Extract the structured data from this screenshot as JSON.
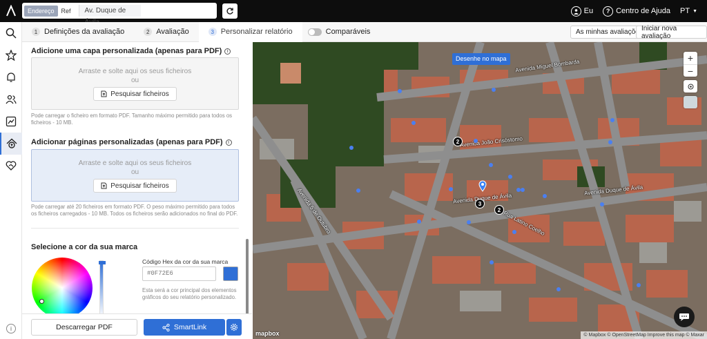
{
  "topbar": {
    "search_modes": [
      "Endereço",
      "Ref"
    ],
    "address_value": "Av. Duque de Ávila ...",
    "user_label": "Eu",
    "help_label": "Centro de Ajuda",
    "language": "PT"
  },
  "tabs": [
    {
      "num": "1",
      "label": "Definições da avaliação"
    },
    {
      "num": "2",
      "label": "Avaliação"
    },
    {
      "num": "3",
      "label": "Personalizar relatório"
    }
  ],
  "toggle_label": "Comparáveis",
  "buttons": {
    "my_evaluations": "As minhas avaliações",
    "new_evaluation": "Iniciar nova avaliação",
    "download_pdf": "Descarregar PDF",
    "smartlink": "SmartLink"
  },
  "cover": {
    "title": "Adicione uma capa personalizada (apenas para PDF)",
    "drop_line1": "Arraste e solte aqui os seus ficheiros",
    "drop_or": "ou",
    "button": "Pesquisar ficheiros",
    "note": "Pode carregar o ficheiro em formato PDF. Tamanho máximo permitido para todos os ficheiros - 10 MB."
  },
  "pages": {
    "title": "Adicionar páginas personalizadas (apenas para PDF)",
    "drop_line1": "Arraste e solte aqui os seus ficheiros",
    "drop_or": "ou",
    "button": "Pesquisar ficheiros",
    "note": "Pode carregar até 20 ficheiros em formato PDF. O peso máximo permitido para todos os ficheiros carregados - 10 MB. Todos os ficheiros serão adicionados no final do PDF."
  },
  "brand": {
    "title": "Selecione a cor da sua marca",
    "hex_label": "Código Hex da cor da sua marca",
    "hex_value": "#0F72E6",
    "swatch_color": "#2f6fd6",
    "note": "Esta será a cor principal dos elementos gráficos do seu relatório personalizado."
  },
  "map": {
    "draw_button": "Desenhe no mapa",
    "streets": [
      "Avenida Miguel Bombarda",
      "Avenida João Crisóstomo",
      "Avenida Duque de Ávila",
      "Avenida Duque de Ávila",
      "Rua Latino Coelho",
      "Avenida 5 de Outubro"
    ],
    "clusters": [
      "2",
      "3",
      "2"
    ],
    "attribution": "© Mapbox © OpenStreetMap Improve this map © Maxar",
    "brand": "mapbox"
  }
}
